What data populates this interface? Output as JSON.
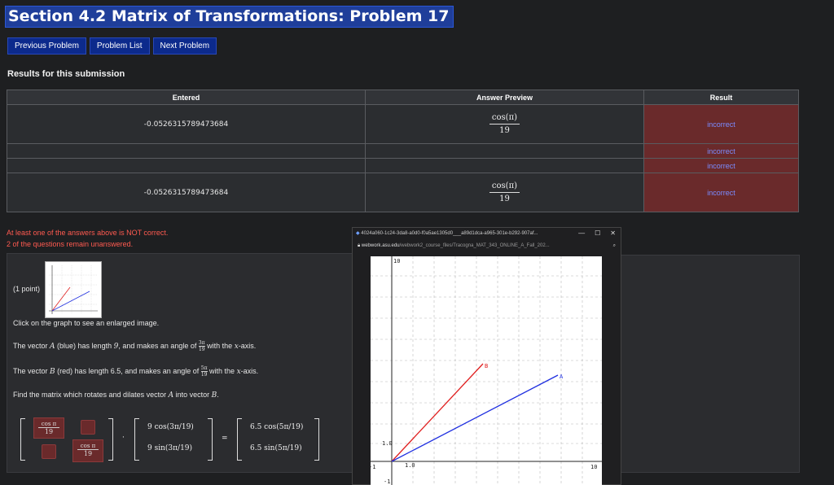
{
  "page": {
    "title": "Section 4.2 Matrix of Transformations: Problem 17"
  },
  "nav": {
    "prev": "Previous Problem",
    "list": "Problem List",
    "next": "Next Problem"
  },
  "results": {
    "heading": "Results for this submission",
    "columns": [
      "Entered",
      "Answer Preview",
      "Result"
    ],
    "rows": [
      {
        "entered": "-0.0526315789473684",
        "preview_num": "cos(π)",
        "preview_den": "19",
        "result": "incorrect"
      },
      {
        "entered": "",
        "preview_num": "",
        "preview_den": "",
        "result": "incorrect"
      },
      {
        "entered": "",
        "preview_num": "",
        "preview_den": "",
        "result": "incorrect"
      },
      {
        "entered": "-0.0526315789473684",
        "preview_num": "cos(π)",
        "preview_den": "19",
        "result": "incorrect"
      }
    ]
  },
  "messages": {
    "not_correct": "At least one of the answers above is NOT correct.",
    "unanswered": "2 of the questions remain unanswered."
  },
  "problem": {
    "points": "(1 point)",
    "click_hint": "Click on the graph to see an enlarged image.",
    "vector_a_1": "The vector ",
    "vector_a_name": "A",
    "vector_a_2": " (blue) has length ",
    "vector_a_len": "9",
    "vector_a_3": ", and makes an angle of ",
    "vector_a_ang_num": "3π",
    "vector_a_ang_den": "19",
    "vector_a_4": " with the ",
    "x_var": "x",
    "axis_word": "-axis.",
    "vector_b_1": "The vector ",
    "vector_b_name": "B",
    "vector_b_2": " (red) has length 6.5, and makes an angle of ",
    "vector_b_ang_num": "5π",
    "vector_b_ang_den": "19",
    "vector_b_3": " with the ",
    "find_1": "Find the matrix which rotates and dilates vector ",
    "find_a": "A",
    "find_2": " into vector ",
    "find_b": "B",
    "find_3": ".",
    "matrix": {
      "a11_num": "cos π",
      "a11_den": "19",
      "a22_num": "cos π",
      "a22_den": "19"
    },
    "vecA_top": "9 cos(3π/19)",
    "vecA_bottom": "9 sin(3π/19)",
    "vecB_top": "6.5 cos(5π/19)",
    "vecB_bottom": "6.5 sin(5π/19)",
    "dot": "·",
    "equals": "="
  },
  "popup": {
    "tab_title": "4024a060-1c24-3da8-a0d0-f0a5ae1305d0___a89d1dca-a965-301e-b292-907af...",
    "controls": [
      "—",
      "☐",
      "✕"
    ],
    "url_host": "webwork.asu.edu",
    "url_path": "/webwork2_course_files/Tracogna_MAT_343_ONLINE_A_Fall_202...",
    "graph": {
      "label_top": "10",
      "label_1y": "1.0",
      "label_1x": "1.0",
      "label_neg1x": "-1",
      "label_neg1y": "-1",
      "label_right": "10",
      "label_B": "B",
      "label_A": "A"
    }
  },
  "colors": {
    "vector_a": "#2030e0",
    "vector_b": "#e02020",
    "incorrect_bg": "#6a2a2b",
    "incorrect_text": "#7a8cff",
    "title_bg": "#1f3e9a"
  },
  "icons": [
    "lock-icon",
    "zoom-icon",
    "webwork-favicon-icon"
  ]
}
